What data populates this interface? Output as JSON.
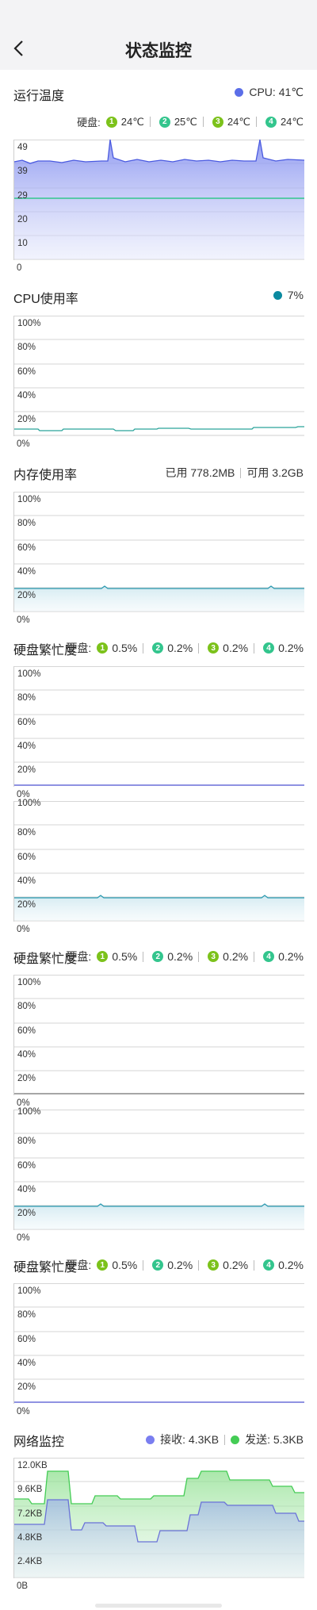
{
  "header": {
    "title": "状态监控",
    "back_icon": "chevron-left-icon"
  },
  "colors": {
    "cpu_blue": "#5b6ee8",
    "green1": "#7cc21b",
    "green2": "#33c58d",
    "teal": "#0b8aa0",
    "receive": "#7a7ef0",
    "send": "#44cc55"
  },
  "temperature": {
    "title": "运行温度",
    "cpu_label": "CPU: 41℃",
    "disk_label": "硬盘:",
    "disks": [
      {
        "num": "1",
        "value": "24℃"
      },
      {
        "num": "2",
        "value": "25℃"
      },
      {
        "num": "3",
        "value": "24℃"
      },
      {
        "num": "4",
        "value": "24℃"
      }
    ],
    "ticks": [
      "49",
      "39",
      "29",
      "20",
      "10"
    ],
    "zero": "0"
  },
  "cpu": {
    "title": "CPU使用率",
    "value": "7%",
    "ticks": [
      "100%",
      "80%",
      "60%",
      "40%",
      "20%"
    ],
    "zero": "0%"
  },
  "memory": {
    "title": "内存使用率",
    "used": "已用 778.2MB",
    "available": "可用 3.2GB",
    "ticks": [
      "100%",
      "80%",
      "60%",
      "40%",
      "20%"
    ],
    "zero": "0%"
  },
  "disk_busy": [
    {
      "title": "硬盘繁忙度",
      "disk_label": "硬盘:",
      "disks": [
        {
          "num": "1",
          "value": "0.5%"
        },
        {
          "num": "2",
          "value": "0.2%"
        },
        {
          "num": "3",
          "value": "0.2%"
        },
        {
          "num": "4",
          "value": "0.2%"
        }
      ],
      "ticks": [
        "100%",
        "80%",
        "60%",
        "40%",
        "20%"
      ],
      "zero": "0%"
    },
    {
      "title": "硬盘繁忙度",
      "disk_label": "硬盘:",
      "disks": [
        {
          "num": "1",
          "value": "0.5%"
        },
        {
          "num": "2",
          "value": "0.2%"
        },
        {
          "num": "3",
          "value": "0.2%"
        },
        {
          "num": "4",
          "value": "0.2%"
        }
      ],
      "ticks": [
        "100%",
        "80%",
        "60%",
        "40%",
        "20%"
      ],
      "zero": "0%"
    },
    {
      "title": "硬盘繁忙度",
      "disk_label": "硬盘:",
      "disks": [
        {
          "num": "1",
          "value": "0.5%"
        },
        {
          "num": "2",
          "value": "0.2%"
        },
        {
          "num": "3",
          "value": "0.2%"
        },
        {
          "num": "4",
          "value": "0.2%"
        }
      ],
      "ticks": [
        "100%",
        "80%",
        "60%",
        "40%",
        "20%"
      ],
      "zero": "0%"
    }
  ],
  "extra_chart": {
    "ticks": [
      "100%",
      "80%",
      "60%",
      "40%",
      "20%"
    ],
    "zero": "0%"
  },
  "network": {
    "title": "网络监控",
    "receive": "接收: 4.3KB",
    "send": "发送: 5.3KB",
    "ticks": [
      "12.0KB",
      "9.6KB",
      "7.2KB",
      "4.8KB",
      "2.4KB"
    ],
    "zero": "0B"
  }
}
